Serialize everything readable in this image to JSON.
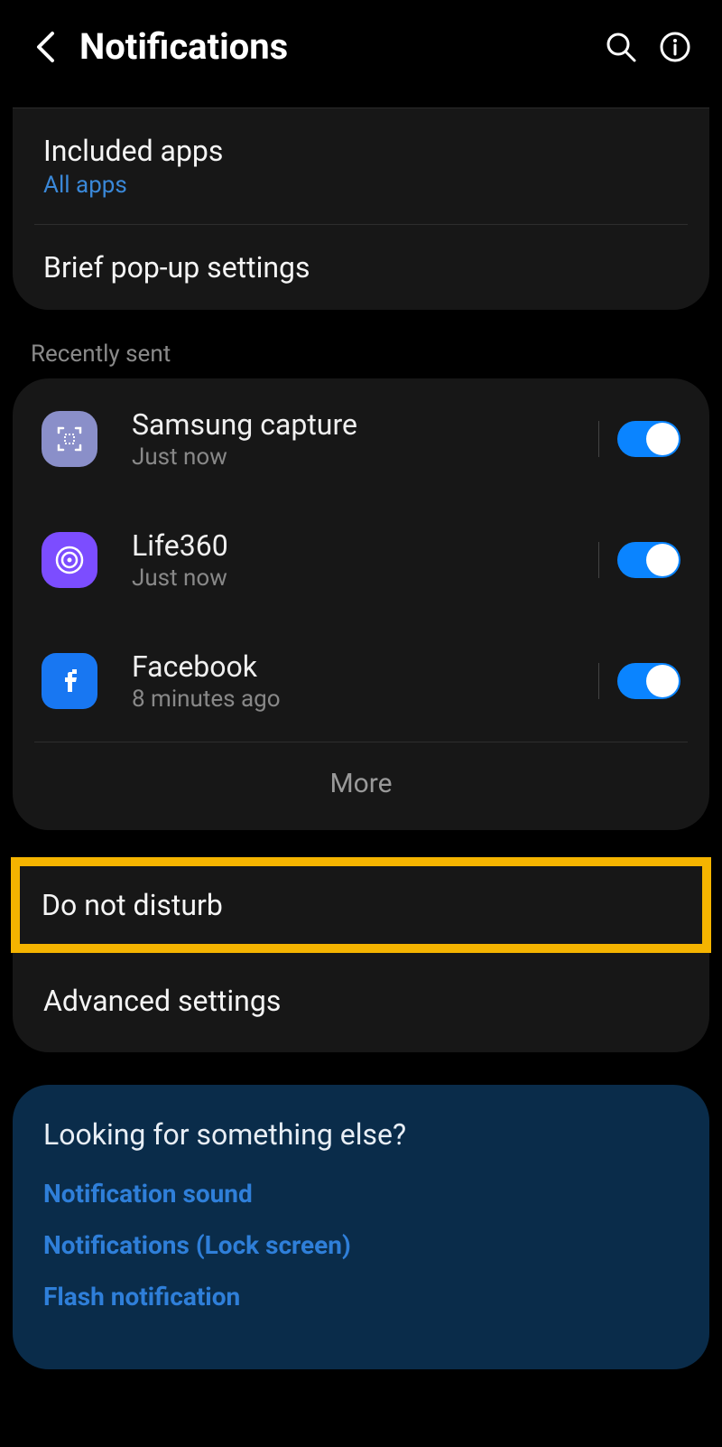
{
  "header": {
    "title": "Notifications"
  },
  "group1": {
    "included_apps": {
      "title": "Included apps",
      "sub": "All apps"
    },
    "brief_popup": {
      "title": "Brief pop-up settings"
    }
  },
  "recently_sent_label": "Recently sent",
  "apps": [
    {
      "name": "Samsung capture",
      "time": "Just now",
      "icon": "samsung-capture",
      "enabled": true
    },
    {
      "name": "Life360",
      "time": "Just now",
      "icon": "life360",
      "enabled": true
    },
    {
      "name": "Facebook",
      "time": "8 minutes ago",
      "icon": "facebook",
      "enabled": true
    }
  ],
  "more_label": "More",
  "settings": {
    "dnd": "Do not disturb",
    "advanced": "Advanced settings"
  },
  "help": {
    "title": "Looking for something else?",
    "links": [
      "Notification sound",
      "Notifications (Lock screen)",
      "Flash notification"
    ]
  }
}
